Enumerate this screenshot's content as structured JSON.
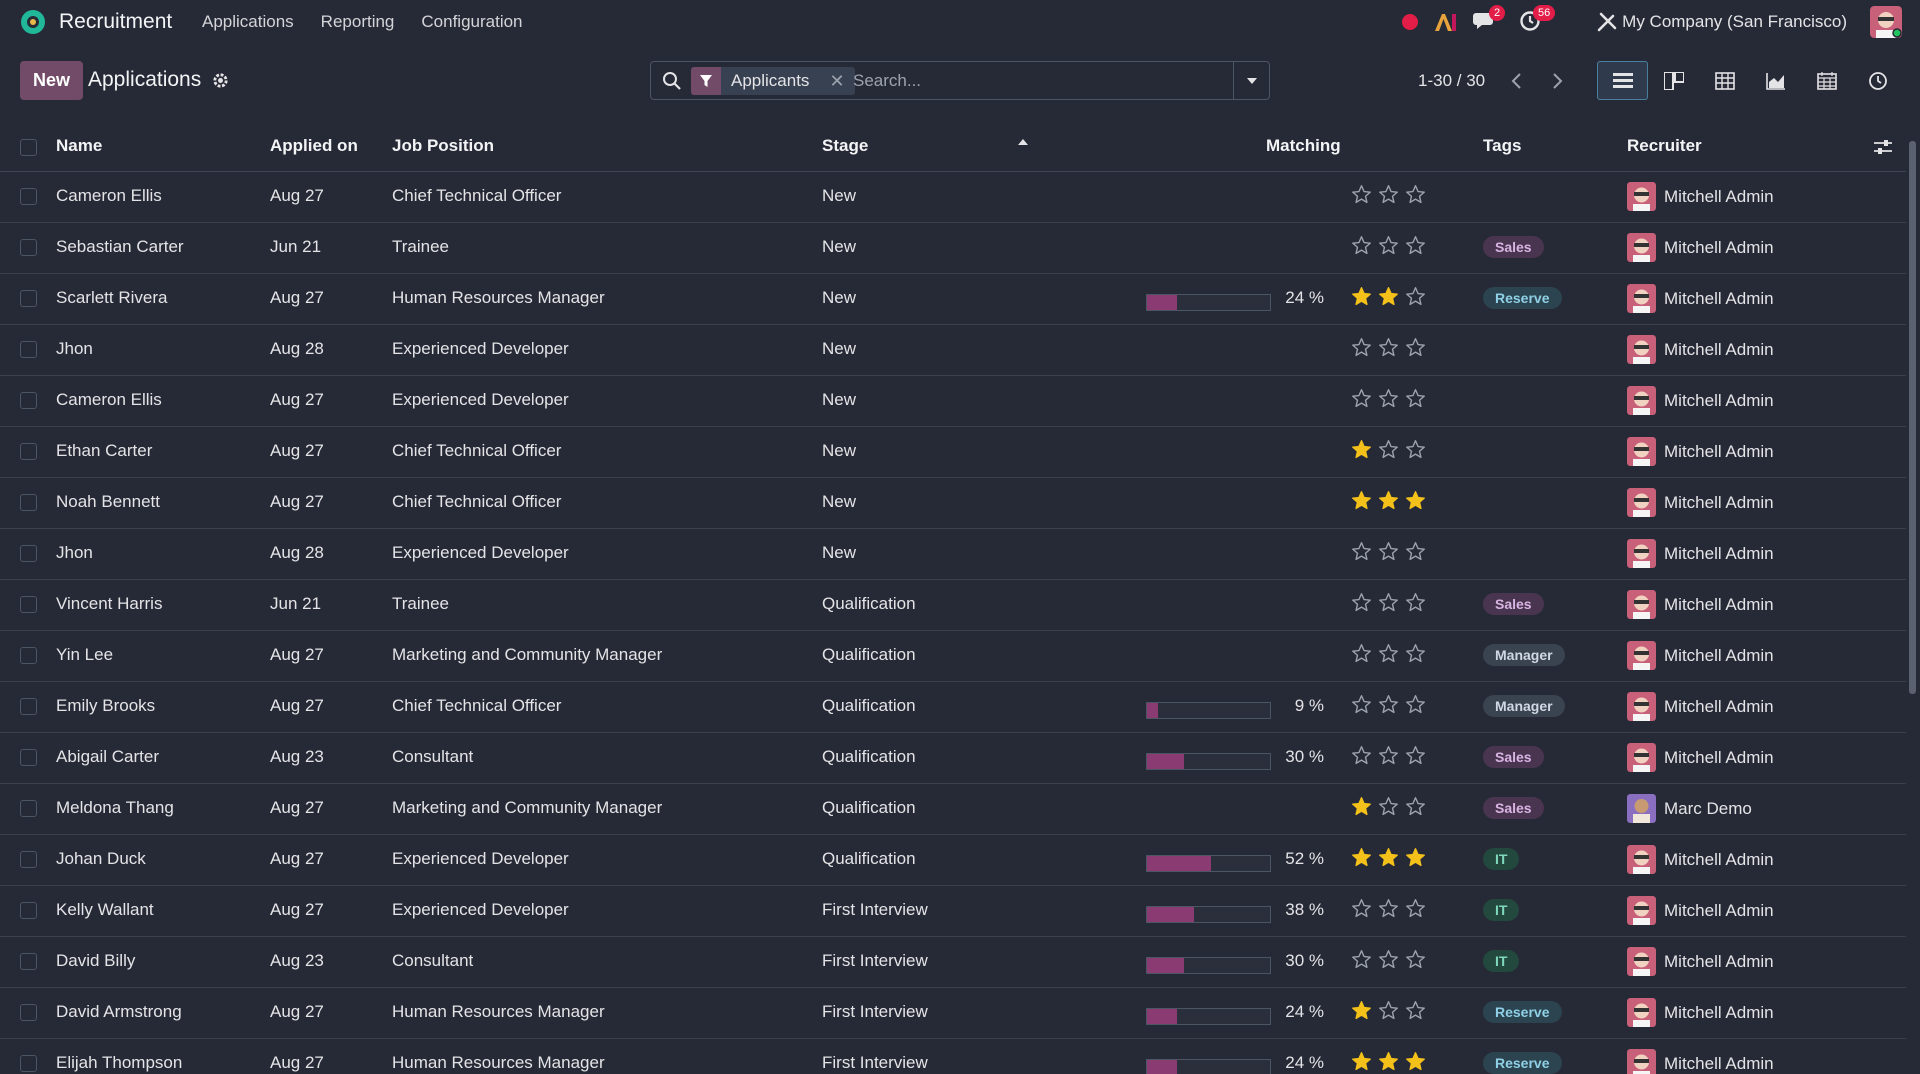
{
  "navbar": {
    "app_name": "Recruitment",
    "menu": [
      "Applications",
      "Reporting",
      "Configuration"
    ],
    "messages_badge": "2",
    "activities_badge": "56",
    "company": "My Company (San Francisco)"
  },
  "control_panel": {
    "new_label": "New",
    "title": "Applications",
    "facet_label": "Applicants",
    "search_placeholder": "Search...",
    "pager": "1-30 / 30"
  },
  "table": {
    "headers": {
      "name": "Name",
      "applied_on": "Applied on",
      "job_position": "Job Position",
      "stage": "Stage",
      "matching": "Matching",
      "tags": "Tags",
      "recruiter": "Recruiter"
    },
    "rows": [
      {
        "name": "Cameron Ellis",
        "applied": "Aug 27",
        "job": "Chief Technical Officer",
        "stage": "New",
        "match": null,
        "match_label": "",
        "stars": 0,
        "tag": "",
        "recruiter": "Mitchell Admin"
      },
      {
        "name": "Sebastian Carter",
        "applied": "Jun 21",
        "job": "Trainee",
        "stage": "New",
        "match": null,
        "match_label": "",
        "stars": 0,
        "tag": "Sales",
        "recruiter": "Mitchell Admin"
      },
      {
        "name": "Scarlett Rivera",
        "applied": "Aug 27",
        "job": "Human Resources Manager",
        "stage": "New",
        "match": 24,
        "match_label": "24 %",
        "stars": 2,
        "tag": "Reserve",
        "recruiter": "Mitchell Admin"
      },
      {
        "name": "Jhon",
        "applied": "Aug 28",
        "job": "Experienced Developer",
        "stage": "New",
        "match": null,
        "match_label": "",
        "stars": 0,
        "tag": "",
        "recruiter": "Mitchell Admin"
      },
      {
        "name": "Cameron Ellis",
        "applied": "Aug 27",
        "job": "Experienced Developer",
        "stage": "New",
        "match": null,
        "match_label": "",
        "stars": 0,
        "tag": "",
        "recruiter": "Mitchell Admin"
      },
      {
        "name": "Ethan Carter",
        "applied": "Aug 27",
        "job": "Chief Technical Officer",
        "stage": "New",
        "match": null,
        "match_label": "",
        "stars": 1,
        "tag": "",
        "recruiter": "Mitchell Admin"
      },
      {
        "name": "Noah Bennett",
        "applied": "Aug 27",
        "job": "Chief Technical Officer",
        "stage": "New",
        "match": null,
        "match_label": "",
        "stars": 3,
        "tag": "",
        "recruiter": "Mitchell Admin"
      },
      {
        "name": "Jhon",
        "applied": "Aug 28",
        "job": "Experienced Developer",
        "stage": "New",
        "match": null,
        "match_label": "",
        "stars": 0,
        "tag": "",
        "recruiter": "Mitchell Admin"
      },
      {
        "name": "Vincent Harris",
        "applied": "Jun 21",
        "job": "Trainee",
        "stage": "Qualification",
        "match": null,
        "match_label": "",
        "stars": 0,
        "tag": "Sales",
        "recruiter": "Mitchell Admin"
      },
      {
        "name": "Yin Lee",
        "applied": "Aug 27",
        "job": "Marketing and Community Manager",
        "stage": "Qualification",
        "match": null,
        "match_label": "",
        "stars": 0,
        "tag": "Manager",
        "recruiter": "Mitchell Admin"
      },
      {
        "name": "Emily Brooks",
        "applied": "Aug 27",
        "job": "Chief Technical Officer",
        "stage": "Qualification",
        "match": 9,
        "match_label": "9 %",
        "stars": 0,
        "tag": "Manager",
        "recruiter": "Mitchell Admin"
      },
      {
        "name": "Abigail Carter",
        "applied": "Aug 23",
        "job": "Consultant",
        "stage": "Qualification",
        "match": 30,
        "match_label": "30 %",
        "stars": 0,
        "tag": "Sales",
        "recruiter": "Mitchell Admin"
      },
      {
        "name": "Meldona Thang",
        "applied": "Aug 27",
        "job": "Marketing and Community Manager",
        "stage": "Qualification",
        "match": null,
        "match_label": "",
        "stars": 1,
        "tag": "Sales",
        "recruiter": "Marc Demo"
      },
      {
        "name": "Johan Duck",
        "applied": "Aug 27",
        "job": "Experienced Developer",
        "stage": "Qualification",
        "match": 52,
        "match_label": "52 %",
        "stars": 3,
        "tag": "IT",
        "recruiter": "Mitchell Admin"
      },
      {
        "name": "Kelly Wallant",
        "applied": "Aug 27",
        "job": "Experienced Developer",
        "stage": "First Interview",
        "match": 38,
        "match_label": "38 %",
        "stars": 0,
        "tag": "IT",
        "recruiter": "Mitchell Admin"
      },
      {
        "name": "David Billy",
        "applied": "Aug 23",
        "job": "Consultant",
        "stage": "First Interview",
        "match": 30,
        "match_label": "30 %",
        "stars": 0,
        "tag": "IT",
        "recruiter": "Mitchell Admin"
      },
      {
        "name": "David Armstrong",
        "applied": "Aug 27",
        "job": "Human Resources Manager",
        "stage": "First Interview",
        "match": 24,
        "match_label": "24 %",
        "stars": 1,
        "tag": "Reserve",
        "recruiter": "Mitchell Admin"
      },
      {
        "name": "Elijah Thompson",
        "applied": "Aug 27",
        "job": "Human Resources Manager",
        "stage": "First Interview",
        "match": 24,
        "match_label": "24 %",
        "stars": 3,
        "tag": "Reserve",
        "recruiter": "Mitchell Admin"
      }
    ]
  },
  "colors": {
    "brand": "#714b67",
    "star_on": "#f3c11a",
    "tag_sales_bg": "#4a3550",
    "tag_sales_fg": "#d8b4e2",
    "tag_reserve_bg": "#2b4450",
    "tag_reserve_fg": "#8fd0e6",
    "tag_manager_bg": "#3a4350",
    "tag_manager_fg": "#cfd8e3",
    "tag_it_bg": "#23483d",
    "tag_it_fg": "#7fd8b9"
  }
}
